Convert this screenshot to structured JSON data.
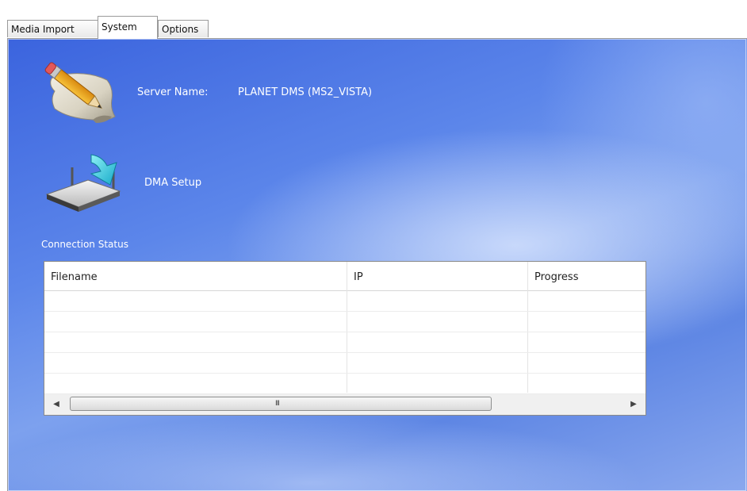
{
  "tabs": [
    {
      "label": "Media Import",
      "active": false
    },
    {
      "label": "System",
      "active": true
    },
    {
      "label": "Options",
      "active": false
    }
  ],
  "server": {
    "label": "Server Name:",
    "value": "PLANET DMS (MS2_VISTA)",
    "icon": "edit-pencil-icon"
  },
  "dma": {
    "label": "DMA Setup",
    "icon": "router-download-icon"
  },
  "connection": {
    "title": "Connection Status",
    "columns": [
      "Filename",
      "IP",
      "Progress"
    ],
    "rows": [],
    "scrollbar_grip": "III"
  },
  "colors": {
    "panel_blue": "#4f78e6",
    "label_text": "#ffffff",
    "tab_border": "#9a9a9a"
  }
}
